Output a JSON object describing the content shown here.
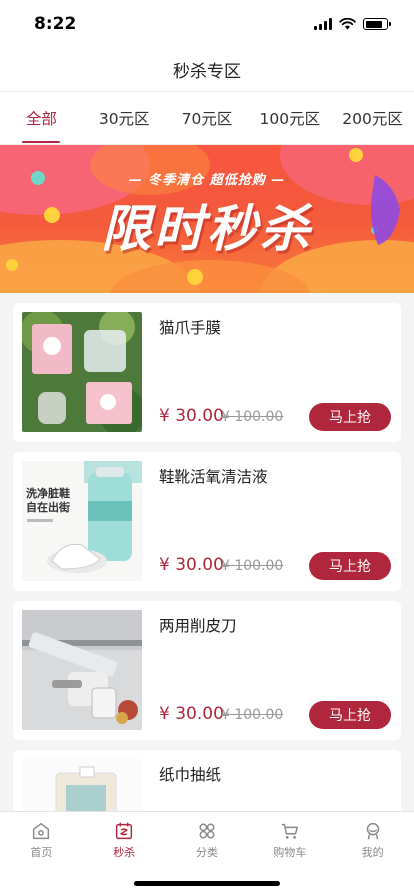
{
  "status_bar": {
    "time": "8:22"
  },
  "nav": {
    "title": "秒杀专区"
  },
  "tabs": [
    {
      "label": "全部",
      "active": true
    },
    {
      "label": "30元区",
      "active": false
    },
    {
      "label": "70元区",
      "active": false
    },
    {
      "label": "100元区",
      "active": false
    },
    {
      "label": "200元区",
      "active": false
    }
  ],
  "banner": {
    "subtitle": "— 冬季清仓   超低抢购 —",
    "title": "限时秒杀"
  },
  "products": [
    {
      "name": "猫爪手膜",
      "price": "¥ 30.00",
      "original_price": "¥ 100.00",
      "button": "马上抢"
    },
    {
      "name": "鞋靴活氧清洁液",
      "price": "¥ 30.00",
      "original_price": "¥ 100.00",
      "button": "马上抢",
      "image_text_line1": "洗净脏鞋",
      "image_text_line2": "自在出街"
    },
    {
      "name": "两用削皮刀",
      "price": "¥ 30.00",
      "original_price": "¥ 100.00",
      "button": "马上抢"
    },
    {
      "name": "纸巾抽纸"
    }
  ],
  "tabbar": [
    {
      "label": "首页",
      "icon": "home-icon",
      "active": false
    },
    {
      "label": "秒杀",
      "icon": "flash-sale-icon",
      "active": true
    },
    {
      "label": "分类",
      "icon": "category-icon",
      "active": false
    },
    {
      "label": "购物车",
      "icon": "cart-icon",
      "active": false
    },
    {
      "label": "我的",
      "icon": "profile-icon",
      "active": false
    }
  ],
  "colors": {
    "accent": "#b0263c",
    "banner": "#f45a3c"
  }
}
